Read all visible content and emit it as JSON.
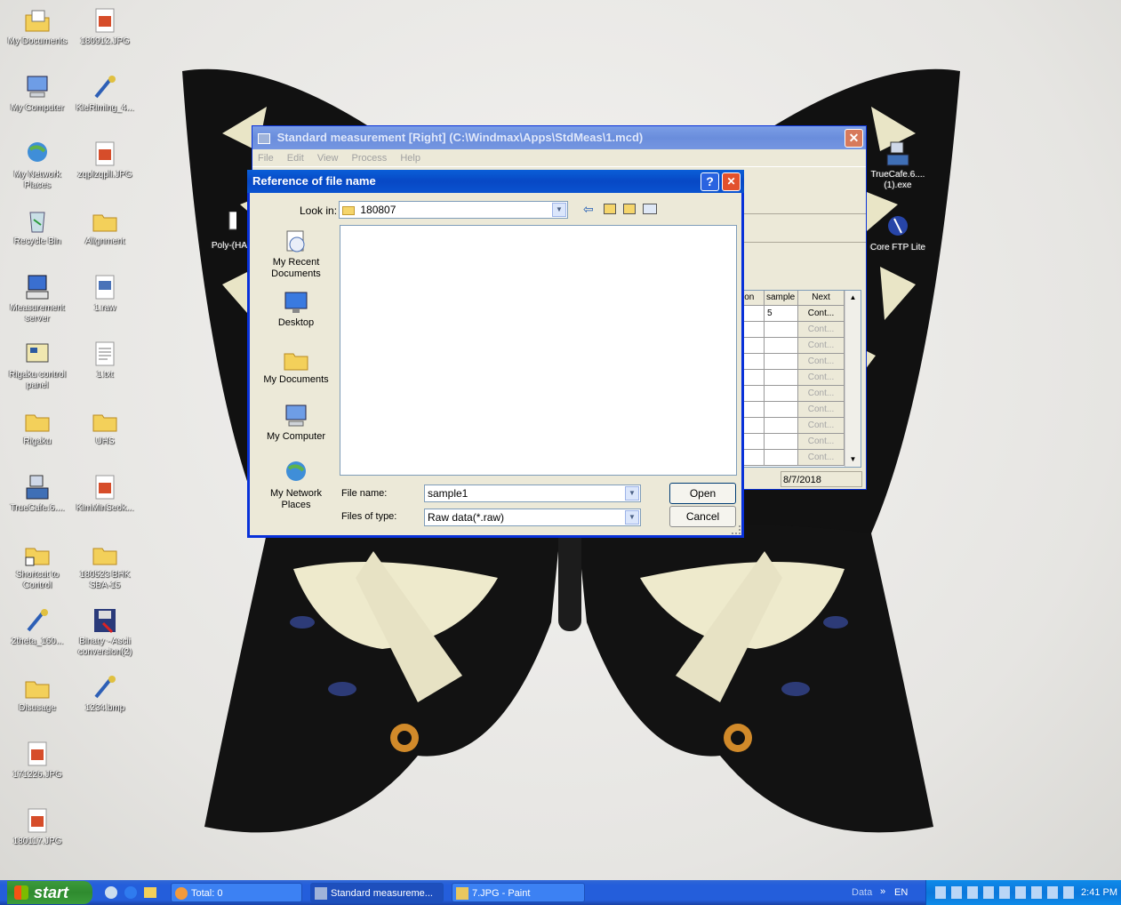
{
  "desktop": {
    "icons_left": [
      {
        "label": "My Documents",
        "icon": "my-documents-icon"
      },
      {
        "label": "My Computer",
        "icon": "my-computer-icon"
      },
      {
        "label": "My Network Places",
        "icon": "network-places-icon"
      },
      {
        "label": "Recycle Bin",
        "icon": "recycle-bin-icon"
      },
      {
        "label": "Measurement server",
        "icon": "server-icon"
      },
      {
        "label": "Rigaku control panel",
        "icon": "control-panel-icon"
      },
      {
        "label": "Rigaku",
        "icon": "folder-icon"
      },
      {
        "label": "TrueCafe.6....",
        "icon": "network-install-icon"
      },
      {
        "label": "Shortcut to Control",
        "icon": "folder-shortcut-icon"
      },
      {
        "label": "2theta_160...",
        "icon": "paint-file-icon"
      },
      {
        "label": "Disusage",
        "icon": "folder-icon"
      },
      {
        "label": "171226.JPG",
        "icon": "jpg-file-icon"
      },
      {
        "label": "180117.JPG",
        "icon": "jpg-file-icon"
      }
    ],
    "icons_right_col": [
      {
        "label": "180912.JPG",
        "icon": "jpg-file-icon"
      },
      {
        "label": "KieRiming_4...",
        "icon": "paint-file-icon"
      },
      {
        "label": "zqplzqpll.JPG",
        "icon": "jpg-file-icon"
      },
      {
        "label": "Alignment",
        "icon": "folder-icon"
      },
      {
        "label": "1.raw",
        "icon": "raw-file-icon"
      },
      {
        "label": "1.txt",
        "icon": "text-file-icon"
      },
      {
        "label": "UHS",
        "icon": "folder-icon"
      },
      {
        "label": "KimMinSeok...",
        "icon": "jpg-file-icon"
      },
      {
        "label": "180523 BHK SBA-15",
        "icon": "folder-icon"
      },
      {
        "label": "Binary - Ascii conversion(2)",
        "icon": "floppy-icon"
      },
      {
        "label": "1234.bmp",
        "icon": "paint-file-icon"
      }
    ],
    "icons_far_right": [
      {
        "label": "TrueCafe.6....(1).exe",
        "icon": "network-install-icon"
      },
      {
        "label": "Core FTP Lite",
        "icon": "ftp-icon"
      }
    ],
    "partial_icon_label": "Poly-(HA"
  },
  "bg_window": {
    "title": "Standard measurement [Right] (C:\\Windmax\\Apps\\StdMeas\\1.mcd)",
    "menu": [
      "File",
      "Edit",
      "View",
      "Process",
      "Help"
    ],
    "table_headers": [
      "ion",
      "sample",
      "Next"
    ],
    "rows": [
      {
        "c1": "",
        "sample": "5",
        "next": "Cont..."
      },
      {
        "c1": "",
        "sample": "",
        "next": "Cont..."
      },
      {
        "c1": "",
        "sample": "",
        "next": "Cont..."
      },
      {
        "c1": "",
        "sample": "",
        "next": "Cont..."
      },
      {
        "c1": "",
        "sample": "",
        "next": "Cont..."
      },
      {
        "c1": "",
        "sample": "",
        "next": "Cont..."
      },
      {
        "c1": "",
        "sample": "",
        "next": "Cont..."
      },
      {
        "c1": "",
        "sample": "",
        "next": "Cont..."
      },
      {
        "c1": "",
        "sample": "",
        "next": "Cont..."
      },
      {
        "c1": "",
        "sample": "",
        "next": "Cont..."
      }
    ],
    "status_date": "8/7/2018"
  },
  "dialog": {
    "title": "Reference of file name",
    "help_btn": "?",
    "close_btn": "✕",
    "look_in_label": "Look in:",
    "look_in_value": "180807",
    "places": [
      "My Recent Documents",
      "Desktop",
      "My Documents",
      "My Computer",
      "My Network Places"
    ],
    "file_name_label": "File name:",
    "file_name_value": "sample1",
    "files_of_type_label": "Files of type:",
    "files_of_type_value": "Raw data(*.raw)",
    "open_btn": "Open",
    "cancel_btn": "Cancel"
  },
  "taskbar": {
    "start": "start",
    "tasks": [
      "Total: 0",
      "Standard measureme...",
      "7.JPG - Paint"
    ],
    "tray_data": "Data",
    "tray_lang": "EN",
    "clock": "2:41 PM"
  }
}
